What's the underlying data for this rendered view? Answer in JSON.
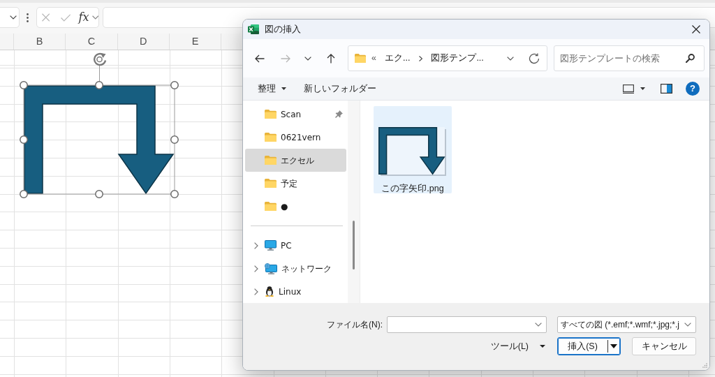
{
  "spreadsheet": {
    "formula_bar": {
      "function_label": "fx"
    },
    "column_headers": [
      "B",
      "C",
      "D",
      "E"
    ],
    "shape": {
      "selected": true
    }
  },
  "dialog": {
    "title": "図の挿入",
    "navigation": {
      "back_enabled": true,
      "forward_enabled": false,
      "address": {
        "overflow_mark": "«",
        "crumbs": [
          "エク...",
          "図形テンプ..."
        ]
      },
      "search": {
        "placeholder": "図形テンプレートの検索"
      }
    },
    "toolbar": {
      "organize": "整理",
      "new_folder": "新しいフォルダー",
      "help": "?"
    },
    "nav_pane": {
      "quick_access": [
        {
          "label": "Scan",
          "pinned": true,
          "selected": false
        },
        {
          "label": "0621vern",
          "pinned": false,
          "selected": false
        },
        {
          "label": "エクセル",
          "pinned": false,
          "selected": true
        },
        {
          "label": "予定",
          "pinned": false,
          "selected": false
        },
        {
          "label": "●",
          "pinned": false,
          "selected": false
        }
      ],
      "locations": [
        {
          "kind": "pc",
          "label": "PC",
          "expanded": false,
          "selected": false
        },
        {
          "kind": "network",
          "label": "ネットワーク",
          "expanded": false,
          "selected": false
        },
        {
          "kind": "linux",
          "label": "Linux",
          "expanded": false,
          "selected": false
        }
      ]
    },
    "files": [
      {
        "name": "この字矢印.png",
        "selected": true
      }
    ],
    "footer": {
      "file_name_label": "ファイル名(N):",
      "file_type": "すべての図 (*.emf;*.wmf;*.jpg;*.j",
      "tools": "ツール(L)",
      "buttons": [
        {
          "label": "挿入(S)",
          "kind": "split",
          "default": true
        },
        {
          "label": "キャンセル",
          "kind": "plain",
          "default": false
        }
      ]
    }
  }
}
